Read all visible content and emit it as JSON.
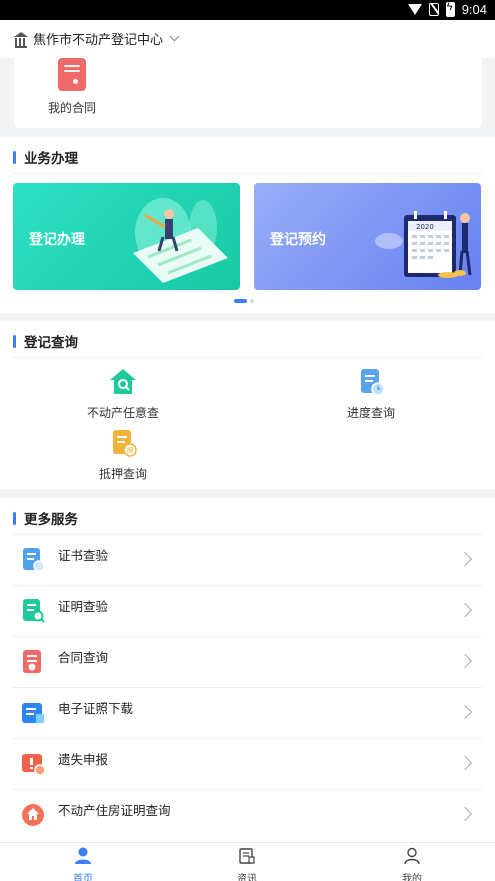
{
  "status_bar": {
    "time": "9:04"
  },
  "header": {
    "title": "焦作市不动产登记中心"
  },
  "contract": {
    "label": "我的合同"
  },
  "business": {
    "title": "业务办理",
    "banners": [
      {
        "label": "登记办理"
      },
      {
        "label": "登记预约",
        "year": "2020"
      }
    ]
  },
  "query": {
    "title": "登记查询",
    "items": [
      {
        "label": "不动产任意查"
      },
      {
        "label": "进度查询"
      },
      {
        "label": "抵押查询"
      }
    ]
  },
  "services": {
    "title": "更多服务",
    "items": [
      {
        "label": "证书查验"
      },
      {
        "label": "证明查验"
      },
      {
        "label": "合同查询"
      },
      {
        "label": "电子证照下载"
      },
      {
        "label": "遗失申报"
      },
      {
        "label": "不动产住房证明查询"
      }
    ]
  },
  "tabbar": [
    {
      "label": "首页"
    },
    {
      "label": "资讯"
    },
    {
      "label": "我的"
    }
  ],
  "colors": {
    "accent": "#3b7ef7",
    "teal": "#1fd3b1",
    "periwinkle": "#7b90f5"
  }
}
